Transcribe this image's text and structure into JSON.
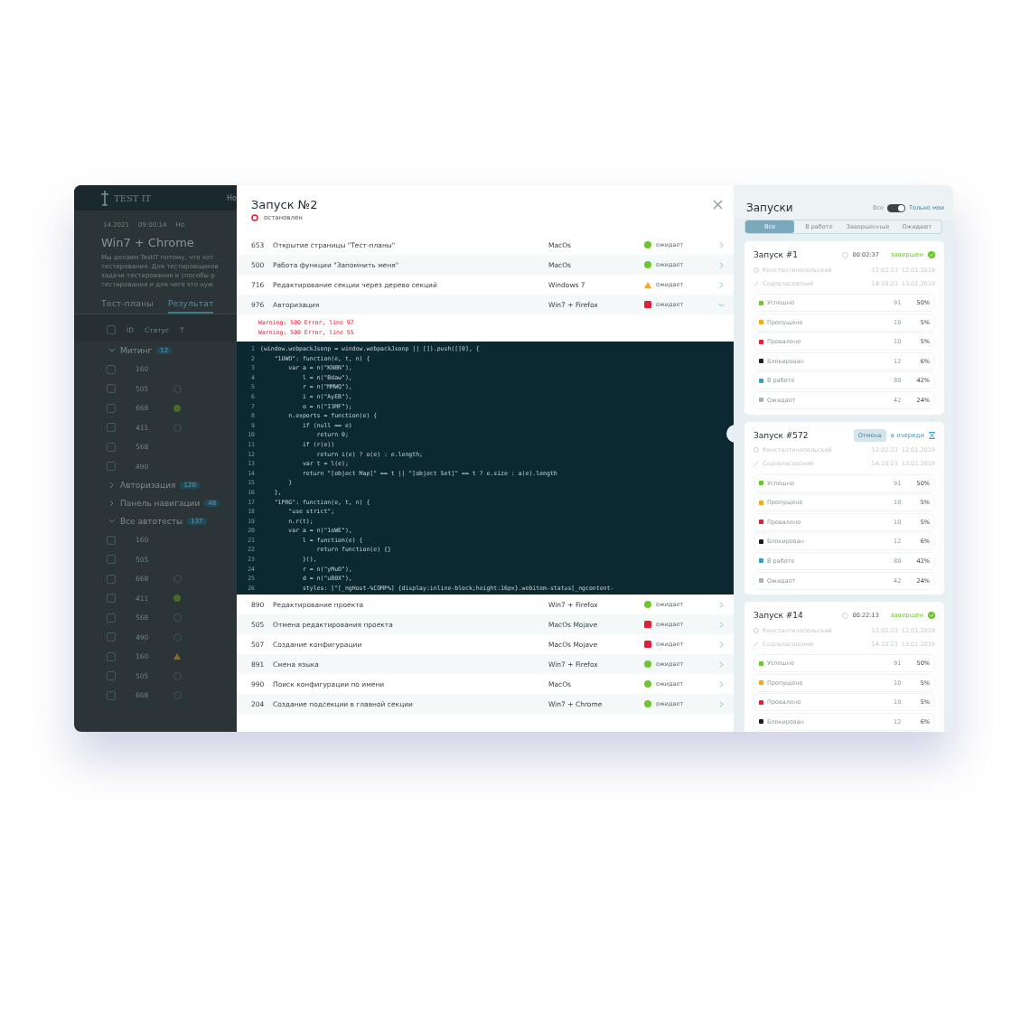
{
  "background_app": {
    "logo": "TEST IT",
    "header_link": "Но",
    "meta": [
      "14.2021",
      "09:00:14",
      "Но"
    ],
    "title": "Win7 + Chrome",
    "description": [
      "Мы делаем TestIT потому, что хот",
      "тестирования. Для тестировщиков",
      "задачи тестирования и способы р",
      "тестирования и для чего это нуж"
    ],
    "tabs": [
      {
        "label": "Тест-планы",
        "selected": false
      },
      {
        "label": "Результат",
        "selected": true
      }
    ],
    "select_all_checked": false,
    "columns": [
      "ID",
      "Статус",
      "Т"
    ],
    "groups": [
      {
        "name": "Митинг",
        "count": "12",
        "expanded": true,
        "rows": [
          {
            "id": "160",
            "kind": "none",
            "checked": false
          },
          {
            "id": "505",
            "kind": "empty",
            "checked": false
          },
          {
            "id": "668",
            "kind": "passed",
            "checked": false
          },
          {
            "id": "411",
            "kind": "empty",
            "checked": false
          },
          {
            "id": "568",
            "kind": "none",
            "checked": false
          },
          {
            "id": "490",
            "kind": "none",
            "checked": false
          }
        ]
      },
      {
        "name": "Авторизация",
        "count": "120",
        "expanded": false
      },
      {
        "name": "Панель навигации",
        "count": "48",
        "expanded": false
      },
      {
        "name": "Все автотесты",
        "count": "137",
        "expanded": true,
        "rows": [
          {
            "id": "160",
            "kind": "none",
            "checked": false
          },
          {
            "id": "505",
            "kind": "none",
            "checked": false
          },
          {
            "id": "668",
            "kind": "empty",
            "checked": false
          },
          {
            "id": "411",
            "kind": "passed",
            "checked": false
          },
          {
            "id": "568",
            "kind": "empty",
            "checked": false
          },
          {
            "id": "490",
            "kind": "empty",
            "checked": false
          },
          {
            "id": "160",
            "kind": "warning",
            "checked": false
          },
          {
            "id": "505",
            "kind": "empty",
            "checked": false
          },
          {
            "id": "668",
            "kind": "empty",
            "checked": false
          }
        ]
      }
    ]
  },
  "run_dialog": {
    "title": "Запуск №2",
    "state": "остановлен",
    "rows_top": [
      {
        "id": "653",
        "name": "Открытие страницы \"Тест-планы\"",
        "config": "MacOs",
        "kind": "passed",
        "status_text": "ожидает",
        "expanded": false
      },
      {
        "id": "500",
        "name": "Работа функции \"Запомнить меня\"",
        "config": "MacOs",
        "kind": "passed",
        "status_text": "ожидает",
        "expanded": false
      },
      {
        "id": "716",
        "name": "Редактирование секции через дерево секций",
        "config": "Windows 7",
        "kind": "warning",
        "status_text": "ожидает",
        "expanded": false
      },
      {
        "id": "976",
        "name": "Авторизация",
        "config": "Win7 + Firefox",
        "kind": "failed",
        "status_text": "ожидает",
        "expanded": true
      }
    ],
    "errors": [
      "Warning: 500 Error, line 97",
      "Warning: 500 Error, line 55"
    ],
    "code": [
      {
        "number": "1",
        "text": "(window.webpackJsonp = window.webpackJsonp || []).push([[0], {"
      },
      {
        "number": "2",
        "text": "    \"1UWO\": function(e, t, n) {"
      },
      {
        "number": "3",
        "text": "        var a = n(\"KNBN\"),"
      },
      {
        "number": "4",
        "text": "            l = n(\"Bdaw\"),"
      },
      {
        "number": "5",
        "text": "            r = n(\"MMWQ\"),"
      },
      {
        "number": "6",
        "text": "            i = n(\"AyEB\"),"
      },
      {
        "number": "7",
        "text": "            o = n(\"I3MF\");"
      },
      {
        "number": "8",
        "text": "        n.exports = function(e) {"
      },
      {
        "number": "9",
        "text": "            if (null == e)"
      },
      {
        "number": "10",
        "text": "                return 0;"
      },
      {
        "number": "11",
        "text": "            if (r(e))"
      },
      {
        "number": "12",
        "text": "                return i(e) ? o(e) : e.length;"
      },
      {
        "number": "13",
        "text": "            var t = l(e);"
      },
      {
        "number": "14",
        "text": "            return \"[object Map]\" == t || \"[object Set]\" == t ? e.size : a(e).length"
      },
      {
        "number": "15",
        "text": "        }"
      },
      {
        "number": "16",
        "text": "    },"
      },
      {
        "number": "17",
        "text": "    \"1PRG\": function(e, t, n) {"
      },
      {
        "number": "18",
        "text": "        \"use strict\";"
      },
      {
        "number": "19",
        "text": "        n.r(t);"
      },
      {
        "number": "20",
        "text": "        var a = n(\"1oWE\"),"
      },
      {
        "number": "21",
        "text": "            l = function(e) {"
      },
      {
        "number": "22",
        "text": "                return function(e) {}"
      },
      {
        "number": "23",
        "text": "            }(),"
      },
      {
        "number": "24",
        "text": "            r = n(\"yMuO\"),"
      },
      {
        "number": "25",
        "text": "            d = n(\"uB0X\"),"
      },
      {
        "number": "26",
        "text": "            styles: [\"[_ngHost-%COMP%] {display:inline-block;height:16px}.webitem-status[_ngcontent-"
      }
    ],
    "rows_bottom": [
      {
        "id": "890",
        "name": "Редактирование проекта",
        "config": "Win7 + Firefox",
        "kind": "passed",
        "status_text": "ожидает",
        "expanded": false
      },
      {
        "id": "505",
        "name": "Отмена редактирования проекта",
        "config": "MacOs Mojave",
        "kind": "failed",
        "status_text": "ожидает",
        "expanded": false
      },
      {
        "id": "507",
        "name": "Создание конфигурации",
        "config": "MacOs Mojave",
        "kind": "failed",
        "status_text": "ожидает",
        "expanded": false
      },
      {
        "id": "891",
        "name": "Смена языка",
        "config": "Win7 + Firefox",
        "kind": "passed",
        "status_text": "ожидает",
        "expanded": false
      },
      {
        "id": "990",
        "name": "Поиск конфигурации по имени",
        "config": "MacOs",
        "kind": "passed",
        "status_text": "ожидает",
        "expanded": false
      },
      {
        "id": "204",
        "name": "Создание подсекции в главной секции",
        "config": "Win7 + Chrome",
        "kind": "passed",
        "status_text": "ожидает",
        "expanded": false
      }
    ]
  },
  "runs_panel": {
    "title": "Запуски",
    "toggle": {
      "label_off": "Все",
      "label_on": "Только мои",
      "on": true
    },
    "tabs": [
      {
        "label": "Все",
        "selected": true
      },
      {
        "label": "В работе",
        "selected": false
      },
      {
        "label": "Завершенные",
        "selected": false
      },
      {
        "label": "Ожидают",
        "selected": false
      }
    ],
    "runs": [
      {
        "title": "Запуск #1",
        "kind": "finished",
        "time": "00:02:37",
        "status": "завершен",
        "people": [
          {
            "name": "Константинопольский",
            "time": "12:02:23",
            "date": "12.01.2019"
          },
          {
            "name": "Седовласовский",
            "time": "14:10:23",
            "date": "13.01.2019"
          }
        ],
        "stats": [
          {
            "label": "Успешно",
            "count": "91",
            "percent": "50%",
            "color": "#6cc62c"
          },
          {
            "label": "Пропущено",
            "count": "10",
            "percent": "5%",
            "color": "#f5a623"
          },
          {
            "label": "Провалено",
            "count": "10",
            "percent": "5%",
            "color": "#e0203a"
          },
          {
            "label": "Блокирован",
            "count": "12",
            "percent": "6%",
            "color": "#1c1c1c"
          },
          {
            "label": "В работе",
            "count": "80",
            "percent": "42%",
            "color": "#3b9cc4"
          },
          {
            "label": "Ожидает",
            "count": "42",
            "percent": "24%",
            "color": "#a9b1b6"
          }
        ]
      },
      {
        "title": "Запуск #572",
        "kind": "queued",
        "cancel": "Отмена",
        "status": "в очереди",
        "people": [
          {
            "name": "Константинопольский",
            "time": "12:02:23",
            "date": "12.01.2019"
          },
          {
            "name": "Седовласовский",
            "time": "14:10:23",
            "date": "13.01.2019"
          }
        ],
        "stats": [
          {
            "label": "Успешно",
            "count": "91",
            "percent": "50%",
            "color": "#6cc62c"
          },
          {
            "label": "Пропущено",
            "count": "10",
            "percent": "5%",
            "color": "#f5a623"
          },
          {
            "label": "Провалено",
            "count": "10",
            "percent": "5%",
            "color": "#e0203a"
          },
          {
            "label": "Блокирован",
            "count": "12",
            "percent": "6%",
            "color": "#1c1c1c"
          },
          {
            "label": "В работе",
            "count": "80",
            "percent": "42%",
            "color": "#3b9cc4"
          },
          {
            "label": "Ожидает",
            "count": "42",
            "percent": "24%",
            "color": "#a9b1b6"
          }
        ]
      },
      {
        "title": "Запуск #14",
        "kind": "finished",
        "time": "00:22:13",
        "status": "завершен",
        "people": [
          {
            "name": "Константинопольский",
            "time": "12:02:23",
            "date": "12.01.2019"
          },
          {
            "name": "Седовласовский",
            "time": "14:10:23",
            "date": "13.01.2019"
          }
        ],
        "stats": [
          {
            "label": "Успешно",
            "count": "91",
            "percent": "50%",
            "color": "#6cc62c"
          },
          {
            "label": "Пропущено",
            "count": "10",
            "percent": "5%",
            "color": "#f5a623"
          },
          {
            "label": "Провалено",
            "count": "10",
            "percent": "5%",
            "color": "#e0203a"
          },
          {
            "label": "Блокирован",
            "count": "12",
            "percent": "6%",
            "color": "#1c1c1c"
          }
        ]
      }
    ]
  }
}
